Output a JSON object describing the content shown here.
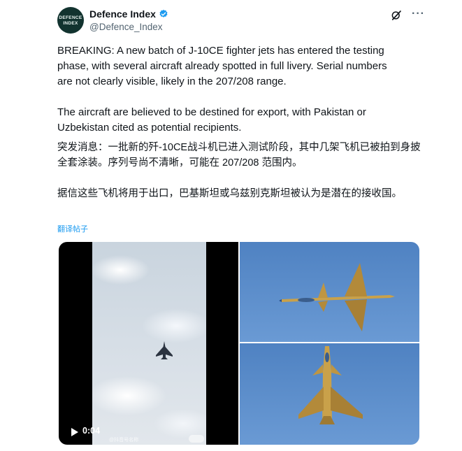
{
  "author": {
    "display_name": "Defence Index",
    "handle": "@Defence_Index",
    "avatar_text": "DEFENCE INDEX",
    "verified_color": "#1d9bf0"
  },
  "tweet": {
    "paragraph_1": "BREAKING: A new batch of J-10CE fighter jets has entered the testing\nphase, with several aircraft already spotted in full livery. Serial numbers\nare not clearly visible, likely in the 207/208 range.",
    "paragraph_2": "The aircraft are believed to be destined for export, with Pakistan or\nUzbekistan cited as potential recipients.",
    "zh_paragraph_1": "突发消息：一批新的歼-10CE战斗机已进入测试阶段，其中几架飞机已被拍到身披全套涂装。序列号尚不清晰，可能在 207/208 范围内。",
    "zh_paragraph_2": "据信这些飞机将用于出口，巴基斯坦或乌兹别克斯坦被认为是潜在的接收国。",
    "translate_label": "翻译帖子"
  },
  "media": {
    "video_duration": "0:04",
    "video_watermark": "@抖音号名称",
    "sky_color": "#5a8ccb",
    "jet_color": "#c9a14a"
  },
  "icons": {
    "grok": "grok-icon",
    "more": "more-icon",
    "play": "play-icon",
    "verified": "verified-badge-icon"
  }
}
